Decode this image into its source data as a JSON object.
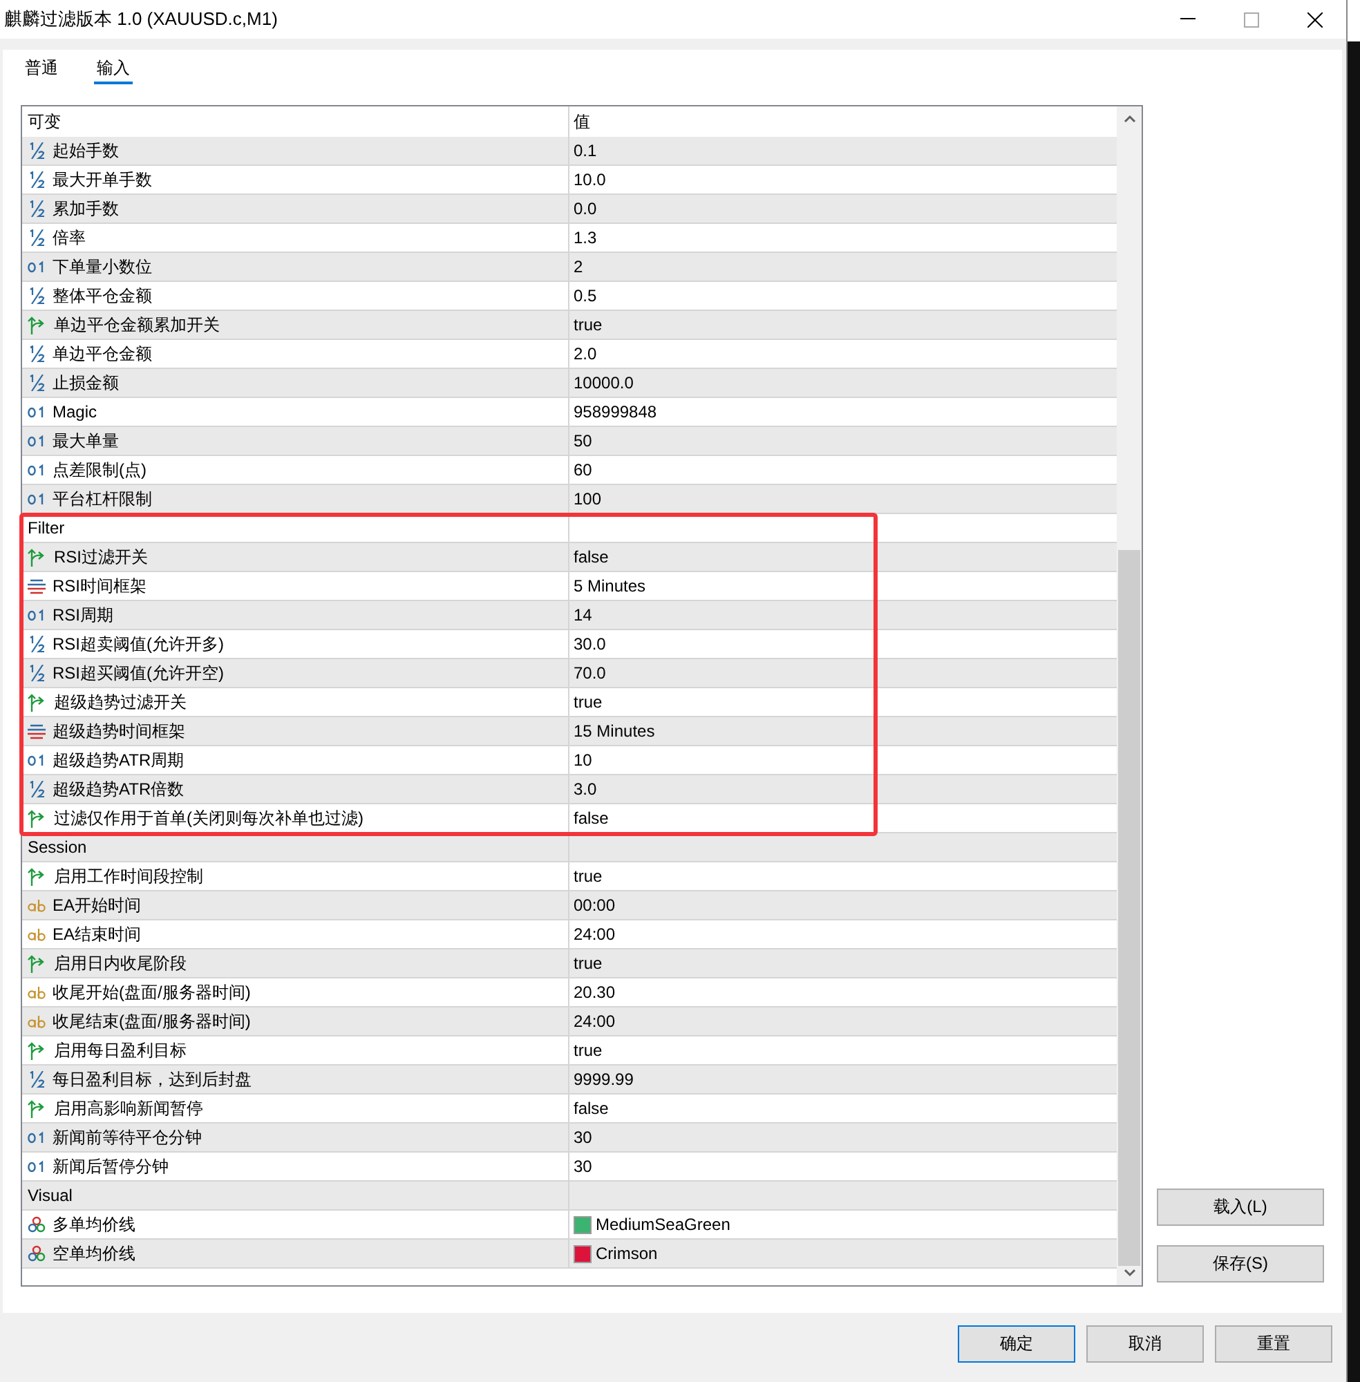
{
  "window": {
    "title": "麒麟过滤版本 1.0 (XAUUSD.c,M1)"
  },
  "tabs": [
    {
      "label": "普通",
      "selected": false
    },
    {
      "label": "输入",
      "selected": true
    }
  ],
  "table": {
    "columns": [
      "可变",
      "值"
    ],
    "rows": [
      {
        "kind": "double",
        "name": "起始手数",
        "value": "0.1"
      },
      {
        "kind": "double",
        "name": "最大开单手数",
        "value": "10.0"
      },
      {
        "kind": "double",
        "name": "累加手数",
        "value": "0.0"
      },
      {
        "kind": "double",
        "name": "倍率",
        "value": "1.3"
      },
      {
        "kind": "int",
        "name": "下单量小数位",
        "value": "2"
      },
      {
        "kind": "double",
        "name": "整体平仓金额",
        "value": "0.5"
      },
      {
        "kind": "bool",
        "name": "单边平仓金额累加开关",
        "value": "true"
      },
      {
        "kind": "double",
        "name": "单边平仓金额",
        "value": "2.0"
      },
      {
        "kind": "double",
        "name": "止损金额",
        "value": "10000.0"
      },
      {
        "kind": "int",
        "name": "Magic",
        "value": "958999848"
      },
      {
        "kind": "int",
        "name": "最大单量",
        "value": "50"
      },
      {
        "kind": "int",
        "name": "点差限制(点)",
        "value": "60"
      },
      {
        "kind": "int",
        "name": "平台杠杆限制",
        "value": "100"
      },
      {
        "kind": "group",
        "name": "Filter"
      },
      {
        "kind": "bool",
        "name": "RSI过滤开关",
        "value": "false"
      },
      {
        "kind": "enum",
        "name": "RSI时间框架",
        "value": "5 Minutes"
      },
      {
        "kind": "int",
        "name": "RSI周期",
        "value": "14"
      },
      {
        "kind": "double",
        "name": "RSI超卖阈值(允许开多)",
        "value": "30.0"
      },
      {
        "kind": "double",
        "name": "RSI超买阈值(允许开空)",
        "value": "70.0"
      },
      {
        "kind": "bool",
        "name": "超级趋势过滤开关",
        "value": "true"
      },
      {
        "kind": "enum",
        "name": "超级趋势时间框架",
        "value": "15 Minutes"
      },
      {
        "kind": "int",
        "name": "超级趋势ATR周期",
        "value": "10"
      },
      {
        "kind": "double",
        "name": "超级趋势ATR倍数",
        "value": "3.0"
      },
      {
        "kind": "bool",
        "name": "过滤仅作用于首单(关闭则每次补单也过滤)",
        "value": "false"
      },
      {
        "kind": "group",
        "name": "Session"
      },
      {
        "kind": "bool",
        "name": "启用工作时间段控制",
        "value": "true"
      },
      {
        "kind": "string",
        "name": "EA开始时间",
        "value": "00:00"
      },
      {
        "kind": "string",
        "name": "EA结束时间",
        "value": "24:00"
      },
      {
        "kind": "bool",
        "name": "启用日内收尾阶段",
        "value": "true"
      },
      {
        "kind": "string",
        "name": "收尾开始(盘面/服务器时间)",
        "value": "20.30"
      },
      {
        "kind": "string",
        "name": "收尾结束(盘面/服务器时间)",
        "value": "24:00"
      },
      {
        "kind": "bool",
        "name": "启用每日盈利目标",
        "value": "true"
      },
      {
        "kind": "double",
        "name": "每日盈利目标，达到后封盘",
        "value": "9999.99"
      },
      {
        "kind": "bool",
        "name": "启用高影响新闻暂停",
        "value": "false"
      },
      {
        "kind": "int",
        "name": "新闻前等待平仓分钟",
        "value": "30"
      },
      {
        "kind": "int",
        "name": "新闻后暂停分钟",
        "value": "30"
      },
      {
        "kind": "group",
        "name": "Visual"
      },
      {
        "kind": "color",
        "name": "多单均价线",
        "value": "MediumSeaGreen",
        "color": "#3cb371"
      },
      {
        "kind": "color",
        "name": "空单均价线",
        "value": "Crimson",
        "color": "#dc143c"
      }
    ]
  },
  "side_buttons": [
    "载入(L)",
    "保存(S)"
  ],
  "buttons": [
    {
      "label": "确定",
      "default": true
    },
    {
      "label": "取消",
      "default": false
    },
    {
      "label": "重置",
      "default": false
    }
  ]
}
